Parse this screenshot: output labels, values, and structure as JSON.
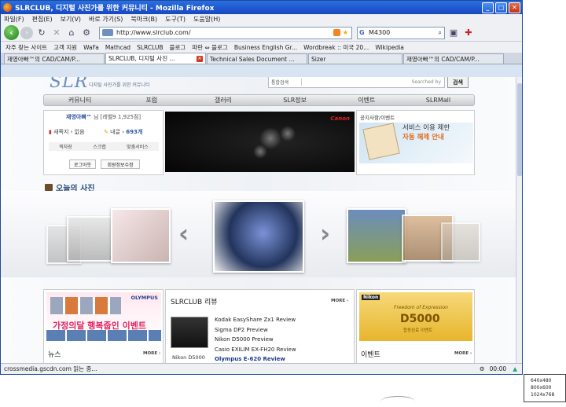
{
  "window": {
    "title": "SLRCLUB, 디지털 사진가를 위한 커뮤니티 - Mozilla Firefox"
  },
  "menubar": [
    "파일(F)",
    "편집(E)",
    "보기(V)",
    "바로 가기(S)",
    "북마크(B)",
    "도구(T)",
    "도움말(H)"
  ],
  "address": {
    "url": "http://www.slrclub.com/"
  },
  "searchbox": {
    "value": "M4300"
  },
  "bookmarks": [
    "자주 찾는 사이트",
    "고객 지원",
    "WaFa",
    "Mathcad",
    "SLRCLUB",
    "블로그",
    "파란 ⇔ 블로그",
    "Business English Gr...",
    "Wordbreak :: 미국 20...",
    "Wikipedia"
  ],
  "tabs": [
    {
      "label": "재영아빠™의 CAD/CAM/P..."
    },
    {
      "label": "SLRCLUB, 디지털 사진 ..."
    },
    {
      "label": "Technical Sales Document ..."
    },
    {
      "label": "Sizer"
    },
    {
      "label": "재영아빠™의 CAD/CAM/P..."
    }
  ],
  "site": {
    "logo": "SLR",
    "tagline": "디지털 사진가를 위한 커뮤니티",
    "search_select": "통합검색",
    "search_by": "Searched by",
    "search_button": "검색",
    "nav": [
      "커뮤니티",
      "포럼",
      "갤러리",
      "SLR정보",
      "이벤트",
      "SLRMall"
    ],
    "user": {
      "name": "재영아빠™",
      "suffix": "님 [레벨9 1,925점]",
      "new_msg_label": "새쪽지",
      "new_msg_value": "없음",
      "my_posts_label": "내글",
      "my_posts_value": "693개",
      "links": [
        "찍자장",
        "스크랩",
        "맞춤서비스"
      ],
      "logout": "로그아웃",
      "edit_info": "회원정보수정"
    },
    "banner": {
      "brand": "Canon"
    },
    "notice": {
      "heading": "공지사항/이벤트",
      "line1": "서비스 이용 제한",
      "line2": "자동 해제 안내"
    },
    "today_heading": "오늘의 사진",
    "ad": {
      "brand": "OLYMPUS",
      "event_text": "가정의달 행복줍인 이벤트"
    },
    "news_heading": "뉴스",
    "review": {
      "heading": "SLRCLUB 리뷰",
      "items": [
        "Kodak EasyShare Zx1 Review",
        "Sigma DP2 Preview",
        "Nikon D5000 Preview",
        "Casio EXILIM EX-FH20 Review",
        "Olympus E-620 Review"
      ],
      "caption": "Nikon D5000"
    },
    "nikon_ad": {
      "brand": "Nikon",
      "tag": "Freedom of Expression",
      "model": "D5000",
      "sub": "합동완료 이벤트"
    },
    "event_heading": "이벤트",
    "more_label": "MORE ›"
  },
  "status": {
    "text": "crossmedia.gscdn.com 읽는 중...",
    "time": "00:00"
  },
  "resolutions": [
    "640x480",
    "800x600",
    "1024x768"
  ]
}
